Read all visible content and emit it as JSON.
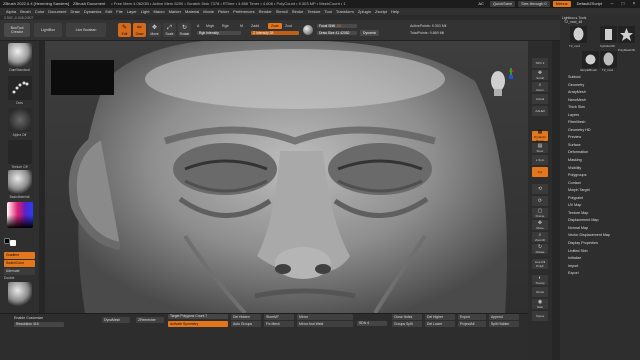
{
  "titlebar": {
    "app": "ZBrush 2022.0.4 [Hemming Sanders]",
    "doc": "ZBrush Document",
    "stats": "• Free Mem 4.062GB • Active Mem 6290 • Scratch Disk 7378 • RTime • 4.656 Timer • 4.608 • PolyCount • 9.303 MP • MeshCount • 1",
    "right_items": [
      "AC",
      "QuickSave",
      "See-through 0",
      "Menus",
      "DefaultZScript"
    ]
  },
  "menubar": {
    "items": [
      "Alpha",
      "Brush",
      "Color",
      "Document",
      "Draw",
      "Dynamics",
      "Edit",
      "File",
      "Layer",
      "Light",
      "Macro",
      "Marker",
      "Material",
      "Movie",
      "Picker",
      "Preferences",
      "Render",
      "Stencil",
      "Stroke",
      "Texture",
      "Tool",
      "Transform",
      "Zplugin",
      "Zscript",
      "Help"
    ]
  },
  "coords": "0.592,-0.045,0.807",
  "shelf": {
    "boxtool": "BoxTool Creator",
    "lightbox": "LightBox",
    "live_boolean": "Live Boolean",
    "modes": [
      {
        "label": "Edit",
        "icon": "✎",
        "active": true
      },
      {
        "label": "Draw",
        "icon": "✏",
        "active": true
      },
      {
        "label": "Move",
        "icon": "✥",
        "active": false
      },
      {
        "label": "Scale",
        "icon": "⤢",
        "active": false
      },
      {
        "label": "Rotate",
        "icon": "↻",
        "active": false
      }
    ],
    "a_label": "A",
    "mrgb": "Mrgb",
    "rgb": "Rgb",
    "m": "M",
    "zadd": "Zadd",
    "zsub": "Zsub",
    "zcut": "Zcut",
    "rgb_intensity": "Rgb Intensity",
    "z_intensity": "Z Intensity 28",
    "focal_shift": "Focal Shift",
    "focal_shift_value": "-54",
    "draw_size": "Draw Size",
    "draw_size_value": "41.42082",
    "dynamic": "Dynamic",
    "active_points": "ActivePoints: 9.303 Mil",
    "total_points": "TotalPoints: 9.869 Mil"
  },
  "leftpanel": {
    "brush": "DamStandard",
    "stroke": "Dots",
    "alpha": "Alpha Off",
    "texture": "Texture Off",
    "material": "BasicMaterial",
    "gradient": "Gradient",
    "switch_color": "SwitchColor",
    "alternate": "Alternate",
    "double": "Double"
  },
  "colors": {
    "accent": "#e4761b",
    "title_bg": "#1c1c1c",
    "panel_bg": "#2f2f2f"
  },
  "righttool": {
    "buttons": [
      "SPix 3",
      "Scroll",
      "Zoom",
      "Actual",
      "AAHalf",
      "Dynamic Persp",
      "Floor",
      "L.Sym",
      "Xyz",
      "",
      "",
      "Frame",
      "Move",
      "ZoomD",
      "Rotate",
      "Line Fill PolyF",
      "Transp",
      "Ghost",
      "Solo",
      "Xpose"
    ]
  },
  "toolpanel": {
    "title": "Lightbox ▸ Tools",
    "subtitle": "T2_mod_48",
    "tiles": [
      "T2_mod",
      "Cylinder3D",
      "PolyMesh3D",
      "SimpleBrush",
      "T2_mod"
    ],
    "menu": [
      "Subtool",
      "Geometry",
      "ArrayMesh",
      "NanoMesh",
      "Thick Skin",
      "Layers",
      "FiberMesh",
      "Geometry HD",
      "Preview",
      "Surface",
      "Deformation",
      "Masking",
      "Visibility",
      "Polygroups",
      "Contact",
      "Morph Target",
      "Polypaint",
      "UV Map",
      "Texture Map",
      "Displacement Map",
      "Normal Map",
      "Vector Displacement Map",
      "Display Properties",
      "Unified Skin",
      "Initialize",
      "Import",
      "Export"
    ]
  },
  "bottombar": {
    "enable_customize": "Enable Customize",
    "resolution": "Resolution 416",
    "dynamesh": "DynaMesh",
    "zremesher": "ZRemesher",
    "target_polycount": "Target Polygons Count 7",
    "activate_symmetry": "Activate Symmetry",
    "del_hidden": "Del Hidden",
    "auto_groups": "Auto Groups",
    "close_holes": "Close Holes",
    "mirror": "Mirror",
    "fix_mesh": "Fix Mesh",
    "mirror_and_weld": "Mirror And Weld",
    "store_mt": "StoreMT",
    "sdiv": "SDiv 4",
    "del_higher": "Del Higher",
    "del_lower": "Del Lower",
    "groups_split": "Groups Split",
    "split_hidden": "Split Hidden",
    "export": "Export",
    "append": "Append",
    "project_all": "ProjectAll"
  }
}
